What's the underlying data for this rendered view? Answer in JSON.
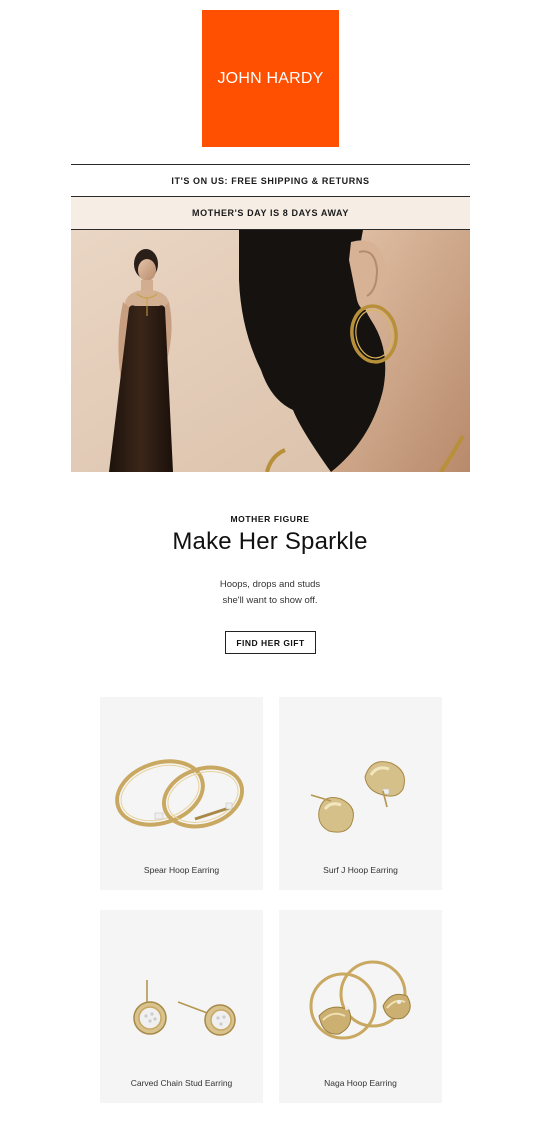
{
  "brand": {
    "logo_text": "JOHN HARDY",
    "brand_color": "#ff4f00"
  },
  "banners": {
    "shipping": "IT'S ON US: FREE SHIPPING & RETURNS",
    "mothers_day": "MOTHER'S DAY IS 8 DAYS AWAY",
    "mothers_day_bg": "#f6ede4"
  },
  "hero": {
    "eyebrow": "MOTHER FIGURE",
    "headline": "Make Her Sparkle",
    "sub_line1": "Hoops, drops and studs",
    "sub_line2": "she'll want to show off.",
    "cta_label": "FIND HER GIFT"
  },
  "products": [
    {
      "name": "Spear Hoop Earring"
    },
    {
      "name": "Surf J Hoop Earring"
    },
    {
      "name": "Carved Chain Stud Earring"
    },
    {
      "name": "Naga Hoop Earring"
    }
  ]
}
